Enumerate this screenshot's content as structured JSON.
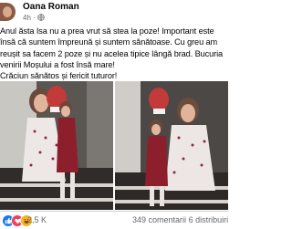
{
  "post": {
    "author": "Oana Roman",
    "time": "4h",
    "privacy_icon": "globe-icon",
    "text": "Anul ăsta Isa nu a prea vrut să stea la poze! Important este însă că suntem împreună și suntem sănătoase. Cu greu am reușit sa facem 2 poze și nu acelea tipice lângă brad. Bucuria venirii Moșului a fost însă mare!\nCrăciun sănătos și fericit tuturor!"
  },
  "photos": [
    {
      "name": "photo-mother-daughter-sitting"
    },
    {
      "name": "photo-mother-daughter-selfie"
    }
  ],
  "footer": {
    "reaction_icons": [
      "like-icon",
      "love-icon",
      "haha-icon"
    ],
    "reaction_count": "2,5 K",
    "comments": "349 comentarii",
    "shares": "6 distribuiri"
  },
  "colors": {
    "secondary_text": "#65676b",
    "like_blue": "#1877f2",
    "love_red": "#f33e58",
    "haha_yellow": "#f7b125"
  }
}
